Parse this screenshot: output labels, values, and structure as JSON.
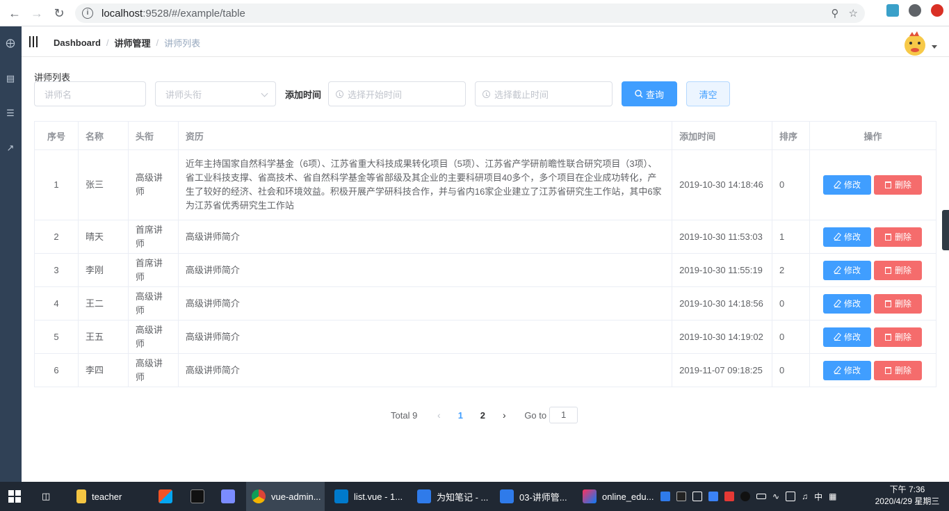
{
  "browser": {
    "url_host": "localhost",
    "url_rest": ":9528/#/example/table"
  },
  "navbar": {
    "breadcrumb": [
      "Dashboard",
      "讲师管理",
      "讲师列表"
    ]
  },
  "filter": {
    "title": "讲师列表",
    "name_placeholder": "讲师名",
    "level_placeholder": "讲师头衔",
    "add_time_label": "添加时间",
    "start_placeholder": "选择开始时间",
    "end_placeholder": "选择截止时间",
    "query_label": "查询",
    "clear_label": "清空"
  },
  "table": {
    "headers": [
      "序号",
      "名称",
      "头衔",
      "资历",
      "添加时间",
      "排序",
      "操作"
    ],
    "edit_label": "修改",
    "delete_label": "删除",
    "rows": [
      {
        "idx": "1",
        "name": "张三",
        "level": "高级讲师",
        "intro": "近年主持国家自然科学基金（6项）、江苏省重大科技成果转化项目（5项）、江苏省产学研前瞻性联合研究项目（3项）、省工业科技支撑、省高技术、省自然科学基金等省部级及其企业的主要科研项目40多个，多个项目在企业成功转化，产生了较好的经济、社会和环境效益。积极开展产学研科技合作，并与省内16家企业建立了江苏省研究生工作站，其中6家为江苏省优秀研究生工作站",
        "time": "2019-10-30 14:18:46",
        "sort": "0"
      },
      {
        "idx": "2",
        "name": "晴天",
        "level": "首席讲师",
        "intro": "高级讲师简介",
        "time": "2019-10-30 11:53:03",
        "sort": "1"
      },
      {
        "idx": "3",
        "name": "李刚",
        "level": "首席讲师",
        "intro": "高级讲师简介",
        "time": "2019-10-30 11:55:19",
        "sort": "2"
      },
      {
        "idx": "4",
        "name": "王二",
        "level": "高级讲师",
        "intro": "高级讲师简介",
        "time": "2019-10-30 14:18:56",
        "sort": "0"
      },
      {
        "idx": "5",
        "name": "王五",
        "level": "高级讲师",
        "intro": "高级讲师简介",
        "time": "2019-10-30 14:19:02",
        "sort": "0"
      },
      {
        "idx": "6",
        "name": "李四",
        "level": "高级讲师",
        "intro": "高级讲师简介",
        "time": "2019-11-07 09:18:25",
        "sort": "0"
      }
    ]
  },
  "pagination": {
    "total": "Total 9",
    "pages": [
      "1",
      "2"
    ],
    "goto_label": "Go to",
    "goto_value": "1"
  },
  "taskbar": {
    "items": [
      "teacher",
      "vue-admin...",
      "list.vue - 1...",
      "为知笔记 - ...",
      "03-讲师管...",
      "online_edu..."
    ],
    "ime": "中",
    "time": "下午 7:36",
    "date": "2020/4/29 星期三"
  }
}
